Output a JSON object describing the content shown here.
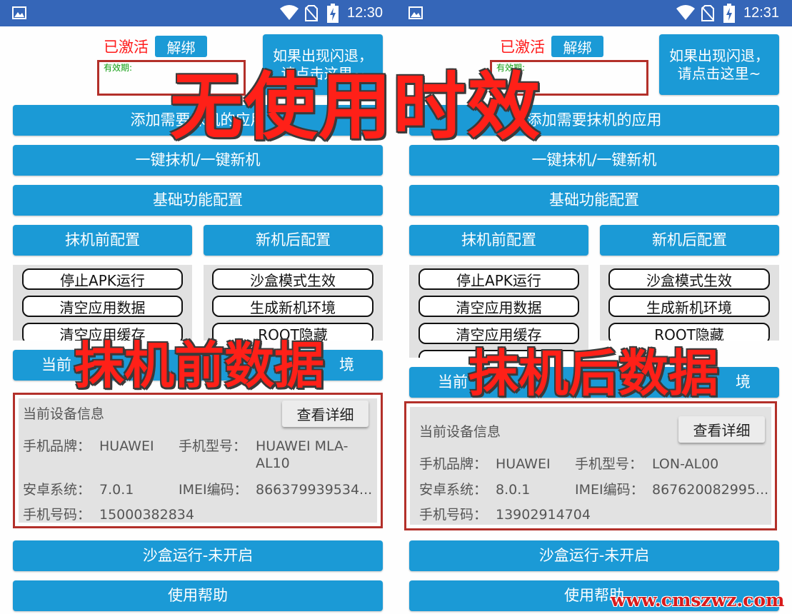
{
  "left_phone": {
    "status_time": "12:30",
    "activated_label": "已激活",
    "unbind_label": "解绑",
    "validity_label": "有效期:",
    "crash_help_label": "如果出现闪退，请点击这里~",
    "add_apps_label": "添加需要抹机的应用",
    "one_key_label": "一键抹机/一键新机",
    "basic_config_label": "基础功能配置",
    "pre_wipe_label": "抹机前配置",
    "post_new_label": "新机后配置",
    "pre_options": [
      "停止APK运行",
      "清空应用数据",
      "清空应用缓存"
    ],
    "post_options": [
      "沙盒模式生效",
      "生成新机环境",
      "ROOT隐藏"
    ],
    "current_data_label": "当前",
    "current_data_tail": "境",
    "device_info": {
      "title": "当前设备信息",
      "details_label": "查看详细",
      "brand_label": "手机品牌：",
      "brand_value": "HUAWEI",
      "model_label": "手机型号：",
      "model_value_1": "HUAWEI MLA-",
      "model_value_2": "AL10",
      "android_label": "安卓系统：",
      "android_value": "7.0.1",
      "imei_label": "IMEI编码：",
      "imei_value": "866379939534...",
      "phone_label": "手机号码：",
      "phone_value": "15000382834"
    },
    "sandbox_label": "沙盒运行-未开启",
    "help_label": "使用帮助"
  },
  "right_phone": {
    "status_time": "12:31",
    "activated_label": "已激活",
    "unbind_label": "解绑",
    "validity_label": "有效期:",
    "crash_help_label": "如果出现闪退，请点击这里~",
    "add_apps_label": "添加需要抹机的应用",
    "one_key_label": "一键抹机/一键新机",
    "basic_config_label": "基础功能配置",
    "pre_wipe_label": "抹机前配置",
    "post_new_label": "新机后配置",
    "pre_options": [
      "停止APK运行",
      "清空应用数据",
      "清空应用缓存"
    ],
    "post_options": [
      "沙盒模式生效",
      "生成新机环境",
      "ROOT隐藏"
    ],
    "current_data_label": "当前",
    "current_data_tail": "境",
    "device_info": {
      "title": "当前设备信息",
      "details_label": "查看详细",
      "brand_label": "手机品牌：",
      "brand_value": "HUAWEI",
      "model_label": "手机型号：",
      "model_value_1": "LON-AL00",
      "android_label": "安卓系统：",
      "android_value": "8.0.1",
      "imei_label": "IMEI编码：",
      "imei_value": "867620082995...",
      "phone_label": "手机号码：",
      "phone_value": "13902914704"
    },
    "sandbox_label": "沙盒运行-未开启",
    "help_label": "使用帮助"
  },
  "overlays": {
    "top": "无使用时效",
    "left": "抹机前数据",
    "right": "抹机后数据"
  },
  "watermark": "www.cmszwz.com",
  "colors": {
    "status_bar": "#3566b8",
    "button_blue": "#1b9ad6",
    "activated_red": "#ff1a1a",
    "validity_green": "#0f9d0f",
    "annotation_red": "#b3302a",
    "overlay_red": "#ff2018"
  }
}
